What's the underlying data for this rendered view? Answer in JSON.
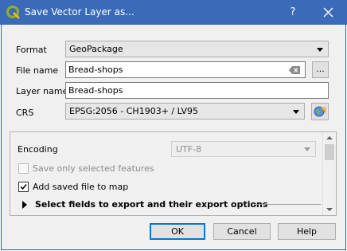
{
  "window": {
    "title": "Save Vector Layer as...",
    "help_glyph": "?",
    "app_icon": "qgis-logo-icon",
    "close_icon": "close-icon"
  },
  "form": {
    "format": {
      "label": "Format",
      "value": "GeoPackage"
    },
    "file_name": {
      "label": "File name",
      "value": "Bread-shops",
      "browse_label": "..."
    },
    "layer_name": {
      "label": "Layer name",
      "value": "Bread-shops"
    },
    "crs": {
      "label": "CRS",
      "value": "EPSG:2056 - CH1903+ / LV95",
      "select_icon": "globe-crs-icon"
    }
  },
  "options": {
    "encoding": {
      "label": "Encoding",
      "value": "UTF-8",
      "enabled": false
    },
    "save_only_selected": {
      "label": "Save only selected features",
      "checked": false,
      "enabled": false
    },
    "add_to_map": {
      "label": "Add saved file to map",
      "checked": true
    },
    "select_fields": {
      "label": "Select fields to export and their export options",
      "expanded": false
    }
  },
  "buttons": {
    "ok": "OK",
    "cancel": "Cancel",
    "help": "Help"
  },
  "colors": {
    "titlebar": "#3b6ab8",
    "dialog_background": "#f0f0f0",
    "default_button_border": "#0078d7"
  }
}
